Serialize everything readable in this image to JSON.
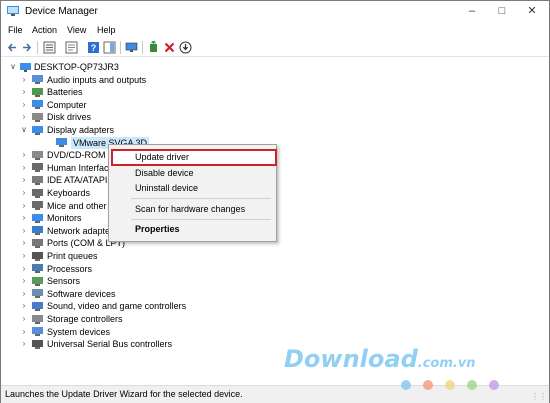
{
  "window": {
    "title": "Device Manager"
  },
  "menu": [
    "File",
    "Action",
    "View",
    "Help"
  ],
  "toolbar": {
    "icons": [
      "back-arrow-icon",
      "forward-arrow-icon",
      "tree-view-icon",
      "properties-icon",
      "help-icon",
      "action-pane-icon",
      "monitor-icon",
      "update-driver-icon",
      "uninstall-icon",
      "download-icon"
    ]
  },
  "tree": {
    "root": "DESKTOP-QP73JR3",
    "items": [
      {
        "label": "Audio inputs and outputs",
        "icon": "audio-icon"
      },
      {
        "label": "Batteries",
        "icon": "battery-icon"
      },
      {
        "label": "Computer",
        "icon": "computer-icon"
      },
      {
        "label": "Disk drives",
        "icon": "disk-icon"
      },
      {
        "label": "Display adapters",
        "icon": "display-adapter-icon",
        "expanded": true
      },
      {
        "label": "VMware SVGA 3D",
        "icon": "display-adapter-icon",
        "child": true,
        "selected": true
      },
      {
        "label": "DVD/CD-ROM dr",
        "icon": "dvd-icon"
      },
      {
        "label": "Human Interface",
        "icon": "hid-icon"
      },
      {
        "label": "IDE ATA/ATAPI co",
        "icon": "ide-icon"
      },
      {
        "label": "Keyboards",
        "icon": "keyboard-icon"
      },
      {
        "label": "Mice and other p",
        "icon": "mouse-icon"
      },
      {
        "label": "Monitors",
        "icon": "monitor-icon"
      },
      {
        "label": "Network adapters",
        "icon": "network-icon"
      },
      {
        "label": "Ports (COM & LPT)",
        "icon": "port-icon"
      },
      {
        "label": "Print queues",
        "icon": "printer-icon"
      },
      {
        "label": "Processors",
        "icon": "processor-icon"
      },
      {
        "label": "Sensors",
        "icon": "sensor-icon"
      },
      {
        "label": "Software devices",
        "icon": "software-device-icon"
      },
      {
        "label": "Sound, video and game controllers",
        "icon": "sound-icon"
      },
      {
        "label": "Storage controllers",
        "icon": "storage-icon"
      },
      {
        "label": "System devices",
        "icon": "system-icon"
      },
      {
        "label": "Universal Serial Bus controllers",
        "icon": "usb-icon"
      }
    ]
  },
  "context_menu": {
    "update": "Update driver",
    "disable": "Disable device",
    "uninstall": "Uninstall device",
    "scan": "Scan for hardware changes",
    "properties": "Properties"
  },
  "status": "Launches the Update Driver Wizard for the selected device.",
  "watermark": {
    "main": "Download",
    "suffix": ".com.vn"
  },
  "colors": {
    "highlight_border": "#d0202a",
    "selection": "#cce8ff"
  }
}
